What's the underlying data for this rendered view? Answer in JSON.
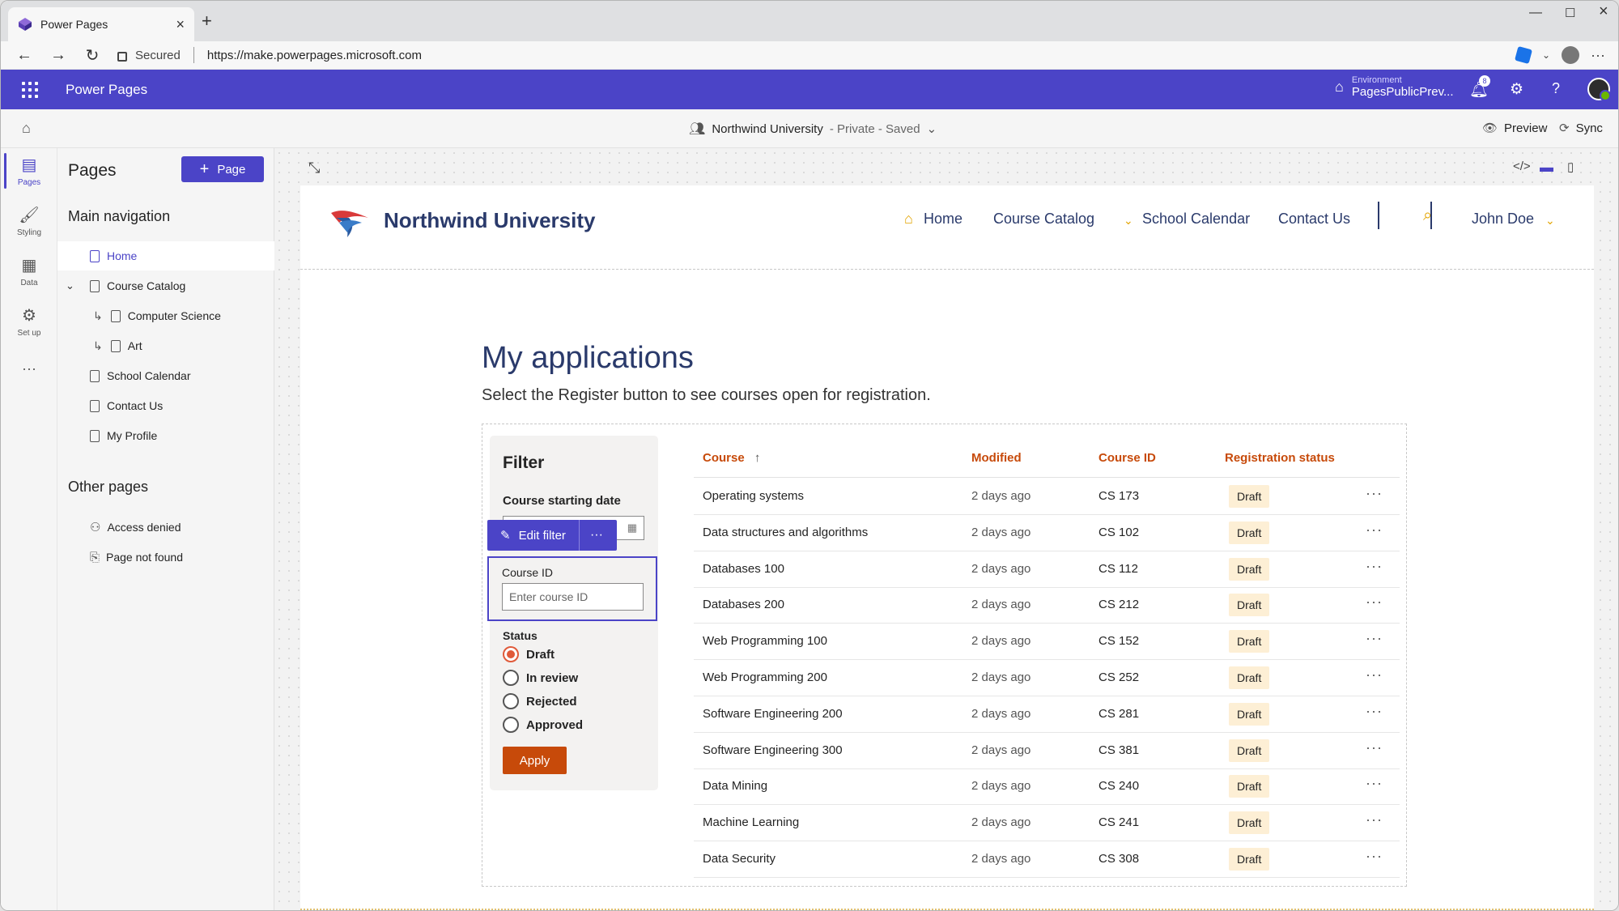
{
  "browser": {
    "tab_title": "Power Pages",
    "secured_label": "Secured",
    "url": "https://make.powerpages.microsoft.com"
  },
  "appbar": {
    "app_name": "Power Pages",
    "environment_label": "Environment",
    "environment_value": "PagesPublicPrev...",
    "notification_count": "8",
    "accent_color": "#4b44c7"
  },
  "sitebar": {
    "site_name": "Northwind University",
    "site_meta": "- Private - Saved",
    "preview_label": "Preview",
    "sync_label": "Sync"
  },
  "rail": [
    {
      "label": "Pages",
      "icon": "pages-icon",
      "active": true
    },
    {
      "label": "Styling",
      "icon": "styling-icon"
    },
    {
      "label": "Data",
      "icon": "data-icon"
    },
    {
      "label": "Set up",
      "icon": "setup-icon"
    }
  ],
  "panel": {
    "title": "Pages",
    "add_page_label": "Page",
    "main_nav_title": "Main navigation",
    "main_nav": [
      {
        "label": "Home",
        "selected": true
      },
      {
        "label": "Course Catalog",
        "expanded": true
      },
      {
        "label": "Computer Science",
        "child": true
      },
      {
        "label": "Art",
        "child": true
      },
      {
        "label": "School Calendar"
      },
      {
        "label": "Contact Us"
      },
      {
        "label": "My Profile"
      }
    ],
    "other_pages_title": "Other pages",
    "other_pages": [
      {
        "label": "Access denied"
      },
      {
        "label": "Page not found"
      }
    ]
  },
  "site": {
    "brand": "Northwind University",
    "nav": [
      "Home",
      "Course Catalog",
      "School Calendar",
      "Contact Us"
    ],
    "user": "John Doe",
    "title": "My applications",
    "subtitle": "Select the Register button to see courses open for registration."
  },
  "filter": {
    "title": "Filter",
    "date_label": "Course starting date",
    "edit_filter_label": "Edit filter",
    "course_id_label": "Course ID",
    "course_id_placeholder": "Enter course ID",
    "status_label": "Status",
    "statuses": [
      "Draft",
      "In review",
      "Rejected",
      "Approved"
    ],
    "selected_status": "Draft",
    "apply_label": "Apply"
  },
  "table": {
    "columns": [
      "Course",
      "Modified",
      "Course ID",
      "Registration status"
    ],
    "sort_indicator": "↑",
    "rows": [
      {
        "course": "Operating systems",
        "modified": "2 days ago",
        "id": "CS 173",
        "status": "Draft"
      },
      {
        "course": "Data structures and algorithms",
        "modified": "2 days ago",
        "id": "CS 102",
        "status": "Draft"
      },
      {
        "course": "Databases 100",
        "modified": "2 days ago",
        "id": "CS 112",
        "status": "Draft"
      },
      {
        "course": "Databases 200",
        "modified": "2 days ago",
        "id": "CS 212",
        "status": "Draft"
      },
      {
        "course": "Web Programming 100",
        "modified": "2 days ago",
        "id": "CS 152",
        "status": "Draft"
      },
      {
        "course": "Web Programming 200",
        "modified": "2 days ago",
        "id": "CS 252",
        "status": "Draft"
      },
      {
        "course": "Software Engineering 200",
        "modified": "2 days ago",
        "id": "CS 281",
        "status": "Draft"
      },
      {
        "course": "Software Engineering 300",
        "modified": "2 days ago",
        "id": "CS 381",
        "status": "Draft"
      },
      {
        "course": "Data Mining",
        "modified": "2 days ago",
        "id": "CS 240",
        "status": "Draft"
      },
      {
        "course": "Machine Learning",
        "modified": "2 days ago",
        "id": "CS 241",
        "status": "Draft"
      },
      {
        "course": "Data Security",
        "modified": "2 days ago",
        "id": "CS 308",
        "status": "Draft"
      }
    ]
  }
}
